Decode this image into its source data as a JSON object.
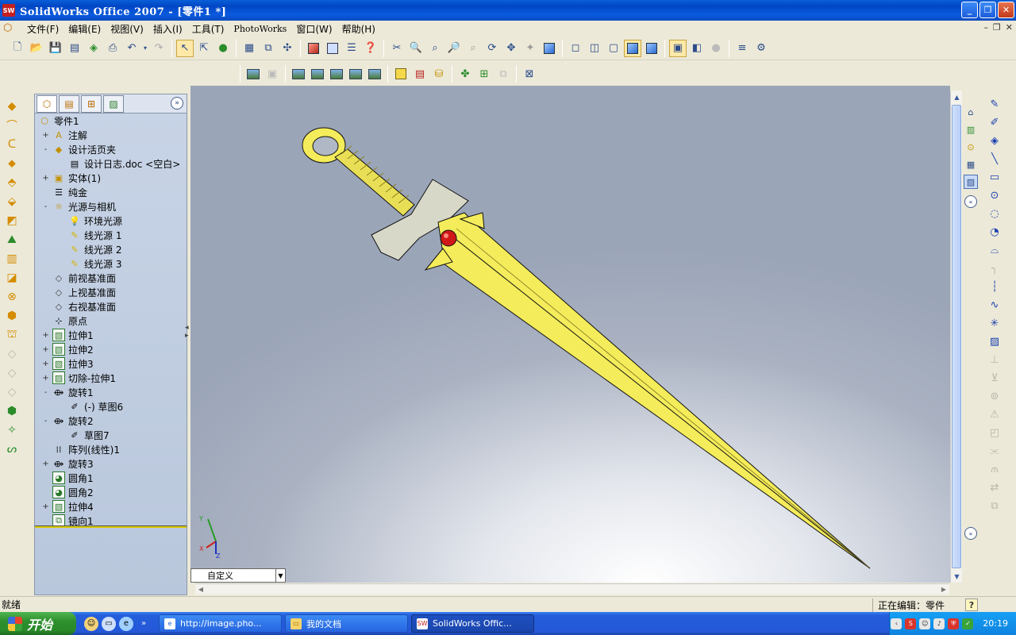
{
  "window": {
    "title": "SolidWorks Office 2007 - [零件1 *]",
    "logo": "SW",
    "minimize": "_",
    "restore": "❐",
    "close": "✕"
  },
  "menu": {
    "items": [
      "文件(F)",
      "编辑(E)",
      "视图(V)",
      "插入(I)",
      "工具(T)",
      "PhotoWorks",
      "窗口(W)",
      "帮助(H)"
    ],
    "doc_buttons": [
      "–",
      "❐",
      "✕"
    ]
  },
  "feature_tree": {
    "rows": [
      {
        "label": "零件1",
        "icon": "part-icon",
        "level": 0,
        "toggle": ""
      },
      {
        "label": "注解",
        "icon": "annotation-icon",
        "level": 1,
        "toggle": "+"
      },
      {
        "label": "设计活页夹",
        "icon": "design-binder-icon",
        "level": 1,
        "toggle": "-"
      },
      {
        "label": "设计日志.doc <空白>",
        "icon": "document-icon",
        "level": 2,
        "toggle": ""
      },
      {
        "label": "实体(1)",
        "icon": "solid-bodies-icon",
        "level": 1,
        "toggle": "+"
      },
      {
        "label": "纯金",
        "icon": "material-icon",
        "level": 1,
        "toggle": ""
      },
      {
        "label": "光源与相机",
        "icon": "lights-cameras-icon",
        "level": 1,
        "toggle": "-"
      },
      {
        "label": "环境光源",
        "icon": "ambient-light-icon",
        "level": 2,
        "toggle": ""
      },
      {
        "label": "线光源 1",
        "icon": "directional-light-icon",
        "level": 2,
        "toggle": ""
      },
      {
        "label": "线光源 2",
        "icon": "directional-light-icon",
        "level": 2,
        "toggle": ""
      },
      {
        "label": "线光源 3",
        "icon": "directional-light-icon",
        "level": 2,
        "toggle": ""
      },
      {
        "label": "前视基准面",
        "icon": "plane-icon",
        "level": 1,
        "toggle": ""
      },
      {
        "label": "上视基准面",
        "icon": "plane-icon",
        "level": 1,
        "toggle": ""
      },
      {
        "label": "右视基准面",
        "icon": "plane-icon",
        "level": 1,
        "toggle": ""
      },
      {
        "label": "原点",
        "icon": "origin-icon",
        "level": 1,
        "toggle": ""
      },
      {
        "label": "拉伸1",
        "icon": "extrude-icon",
        "level": 1,
        "toggle": "+"
      },
      {
        "label": "拉伸2",
        "icon": "extrude-icon",
        "level": 1,
        "toggle": "+"
      },
      {
        "label": "拉伸3",
        "icon": "extrude-icon",
        "level": 1,
        "toggle": "+"
      },
      {
        "label": "切除-拉伸1",
        "icon": "cut-extrude-icon",
        "level": 1,
        "toggle": "+"
      },
      {
        "label": "旋转1",
        "icon": "revolve-icon",
        "level": 1,
        "toggle": "-"
      },
      {
        "label": "(-) 草图6",
        "icon": "sketch-icon",
        "level": 2,
        "toggle": ""
      },
      {
        "label": "旋转2",
        "icon": "revolve-icon",
        "level": 1,
        "toggle": "-"
      },
      {
        "label": "草图7",
        "icon": "sketch-icon",
        "level": 2,
        "toggle": ""
      },
      {
        "label": "阵列(线性)1",
        "icon": "linear-pattern-icon",
        "level": 1,
        "toggle": ""
      },
      {
        "label": "旋转3",
        "icon": "revolve-icon",
        "level": 1,
        "toggle": "+"
      },
      {
        "label": "圆角1",
        "icon": "fillet-icon",
        "level": 1,
        "toggle": ""
      },
      {
        "label": "圆角2",
        "icon": "fillet-icon",
        "level": 1,
        "toggle": ""
      },
      {
        "label": "拉伸4",
        "icon": "extrude-icon",
        "level": 1,
        "toggle": "+"
      },
      {
        "label": "镜向1",
        "icon": "mirror-icon",
        "level": 1,
        "toggle": ""
      }
    ]
  },
  "viewport": {
    "view_orientation": "自定义",
    "triad": {
      "x": "X",
      "y": "Y",
      "z": "Z"
    },
    "model_colors": {
      "blade": "#f4ec5a",
      "guard": "#d8d8c8",
      "gem": "#d01818",
      "edge": "#111111"
    }
  },
  "status": {
    "left": "就绪",
    "right": "正在编辑：零件",
    "help": "?"
  },
  "taskbar": {
    "start": "开始",
    "tasks": [
      {
        "label": "http://image.pho...",
        "active": false
      },
      {
        "label": "我的文档",
        "active": false
      },
      {
        "label": "SolidWorks Offic...",
        "active": true
      }
    ],
    "clock": "20:19"
  }
}
